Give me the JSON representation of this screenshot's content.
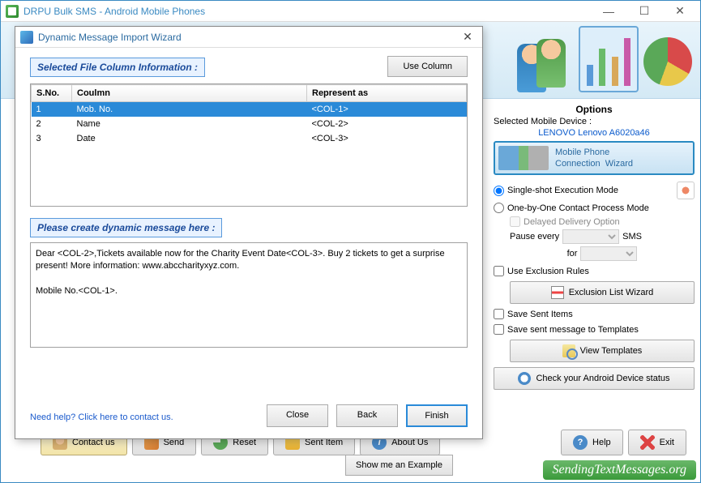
{
  "mainWindow": {
    "title": "DRPU Bulk SMS - Android Mobile Phones"
  },
  "dialog": {
    "title": "Dynamic Message Import Wizard",
    "section1": "Selected File Column Information :",
    "useColumn": "Use Column",
    "columns": {
      "c1": "S.No.",
      "c2": "Coulmn",
      "c3": "Represent as"
    },
    "rows": [
      {
        "sno": "1",
        "col": "Mob. No.",
        "rep": "<COL-1>"
      },
      {
        "sno": "2",
        "col": "Name",
        "rep": "<COL-2>"
      },
      {
        "sno": "3",
        "col": "Date",
        "rep": "<COL-3>"
      }
    ],
    "section2": "Please create dynamic message here :",
    "exampleBtn": "Show me an Example",
    "message": "Dear <COL-2>,Tickets available now for the Charity Event Date<COL-3>. Buy 2 tickets to get a surprise present! More information: www.abccharityxyz.com.\n\nMobile No.<COL-1>.",
    "helpLink": "Need help? Click here to contact us.",
    "btnClose": "Close",
    "btnBack": "Back",
    "btnFinish": "Finish"
  },
  "options": {
    "title": "Options",
    "selDevice": "Selected Mobile Device :",
    "deviceName": "LENOVO Lenovo A6020a46",
    "connWizard": "Mobile Phone\nConnection  Wizard",
    "mode1": "Single-shot Execution Mode",
    "mode2": "One-by-One Contact Process Mode",
    "delayed": "Delayed Delivery Option",
    "pauseEvery": "Pause every",
    "sms": "SMS",
    "for": "for",
    "useExcl": "Use Exclusion Rules",
    "exclBtn": "Exclusion List Wizard",
    "saveSent": "Save Sent Items",
    "saveTpl": "Save sent message to Templates",
    "viewTpl": "View Templates",
    "checkStatus": "Check your Android Device status"
  },
  "toolbar": {
    "contact": "Contact us",
    "send": "Send",
    "reset": "Reset",
    "sentItem": "Sent Item",
    "about": "About Us",
    "help": "Help",
    "exit": "Exit"
  },
  "watermark": "SendingTextMessages.org"
}
